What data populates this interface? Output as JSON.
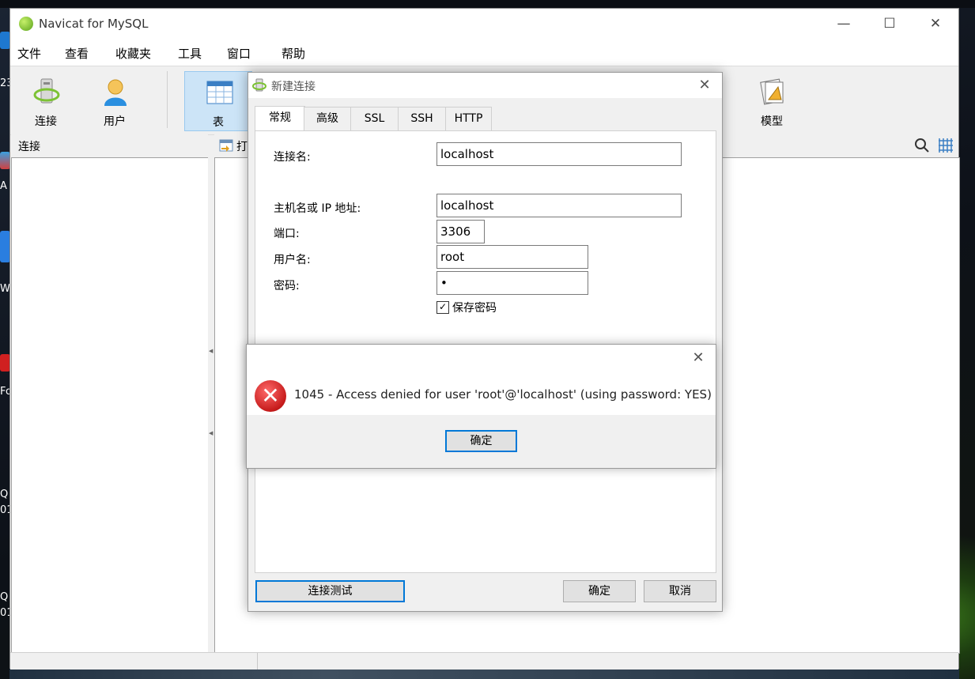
{
  "desktop": {
    "labels": [
      "23",
      "A",
      "W",
      "Fo",
      "Q",
      "01",
      "Q",
      "01"
    ]
  },
  "window": {
    "title": "Navicat for MySQL",
    "minimize_icon": "minimize-icon",
    "maximize_icon": "maximize-icon",
    "close_icon": "close-icon"
  },
  "menu": [
    "文件",
    "查看",
    "收藏夹",
    "工具",
    "窗口",
    "帮助"
  ],
  "toolbar": {
    "connect": "连接",
    "user": "用户",
    "table": "表",
    "model": "模型"
  },
  "panes": {
    "left_header": "连接",
    "right_header_fragment": "打"
  },
  "dialog": {
    "title": "新建连接",
    "tabs": [
      "常规",
      "高级",
      "SSL",
      "SSH",
      "HTTP"
    ],
    "fields": {
      "connection_name_label": "连接名:",
      "connection_name_value": "localhost",
      "host_label": "主机名或 IP 地址:",
      "host_value": "localhost",
      "port_label": "端口:",
      "port_value": "3306",
      "username_label": "用户名:",
      "username_value": "root",
      "password_label": "密码:",
      "password_value": "•",
      "save_password_label": "保存密码",
      "save_password_checked": true
    },
    "buttons": {
      "test": "连接测试",
      "ok": "确定",
      "cancel": "取消"
    }
  },
  "error": {
    "message": "1045 - Access denied for user 'root'@'localhost' (using password: YES)",
    "ok": "确定",
    "icon": "error-icon"
  }
}
